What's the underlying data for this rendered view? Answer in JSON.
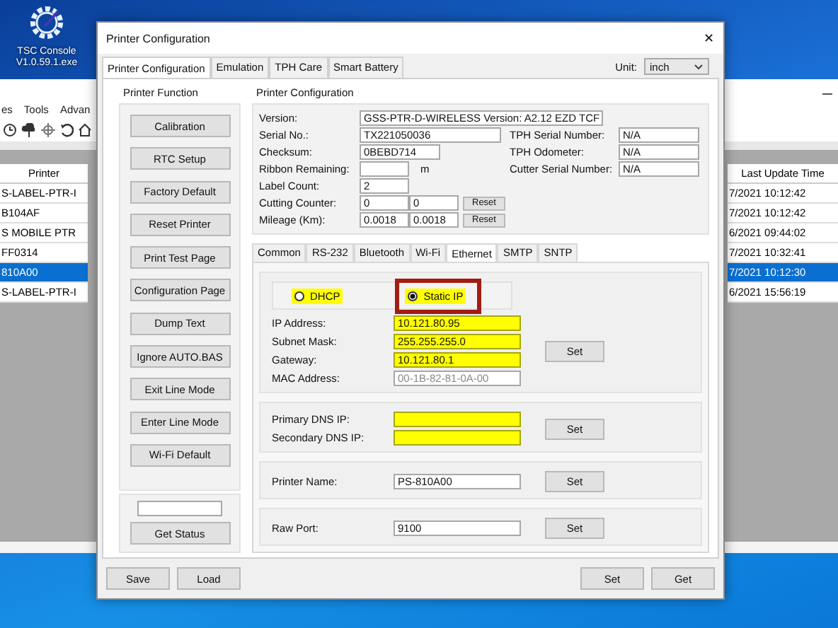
{
  "desktop_icon": {
    "label": "TSC Console V1.0.59.1.exe"
  },
  "background_window": {
    "menu": [
      "es",
      "Tools",
      "Advan"
    ],
    "columns": [
      "Printer",
      "Last Update Time"
    ],
    "rows": [
      {
        "printer": "S-LABEL-PTR-I",
        "time": "7/2021 10:12:42",
        "selected": false
      },
      {
        "printer": "B104AF",
        "time": "7/2021 10:12:42",
        "selected": false
      },
      {
        "printer": "S MOBILE PTR",
        "time": "6/2021 09:44:02",
        "selected": false
      },
      {
        "printer": "FF0314",
        "time": "7/2021 10:32:41",
        "selected": false
      },
      {
        "printer": "810A00",
        "time": "7/2021 10:12:30",
        "selected": true
      },
      {
        "printer": "S-LABEL-PTR-I",
        "time": "6/2021 15:56:19",
        "selected": false
      }
    ]
  },
  "dialog": {
    "title": "Printer Configuration",
    "close": "✕",
    "tabs": [
      {
        "label": "Printer Configuration",
        "selected": true
      },
      {
        "label": "Emulation",
        "selected": false
      },
      {
        "label": "TPH Care",
        "selected": false
      },
      {
        "label": "Smart Battery",
        "selected": false
      }
    ],
    "unit": {
      "label": "Unit:",
      "value": "inch"
    },
    "printer_function": {
      "title": "Printer Function",
      "buttons": [
        "Calibration",
        "RTC Setup",
        "Factory Default",
        "Reset Printer",
        "Print Test Page",
        "Configuration Page",
        "Dump Text",
        "Ignore AUTO.BAS",
        "Exit Line Mode",
        "Enter Line Mode",
        "Wi-Fi Default"
      ],
      "status_button": "Get Status"
    },
    "printer_configuration": {
      "title": "Printer Configuration",
      "version": {
        "label": "Version:",
        "value": "GSS-PTR-D-WIRELESS Version: A2.12 EZD TCF"
      },
      "serial": {
        "label": "Serial No.:",
        "value": "TX221050036"
      },
      "checksum": {
        "label": "Checksum:",
        "value": "0BEBD714"
      },
      "ribbon": {
        "label": "Ribbon Remaining:",
        "unit": "m"
      },
      "label_count": {
        "label": "Label Count:",
        "value": "2"
      },
      "cutting_counter": {
        "label": "Cutting Counter:",
        "values": [
          "0",
          "0"
        ],
        "button": "Reset"
      },
      "mileage": {
        "label": "Mileage (Km):",
        "values": [
          "0.0018",
          "0.0018"
        ],
        "button": "Reset"
      },
      "tph_serial": {
        "label": "TPH Serial Number:",
        "value": "N/A"
      },
      "tph_odometer": {
        "label": "TPH Odometer:",
        "value": "N/A"
      },
      "cutter_serial": {
        "label": "Cutter Serial Number:",
        "value": "N/A"
      }
    },
    "subtabs": [
      {
        "label": "Common",
        "selected": false
      },
      {
        "label": "RS-232",
        "selected": false
      },
      {
        "label": "Bluetooth",
        "selected": false
      },
      {
        "label": "Wi-Fi",
        "selected": false
      },
      {
        "label": "Ethernet",
        "selected": true
      },
      {
        "label": "SMTP",
        "selected": false
      },
      {
        "label": "SNTP",
        "selected": false
      }
    ],
    "ethernet": {
      "modes": [
        {
          "label": "DHCP",
          "selected": false,
          "highlighted": true,
          "annotated": false
        },
        {
          "label": "Static IP",
          "selected": true,
          "highlighted": true,
          "annotated": true
        }
      ],
      "groups": [
        {
          "fields": [
            {
              "label": "IP Address:",
              "value": "10.121.80.95",
              "highlighted": true,
              "disabled": false
            },
            {
              "label": "Subnet Mask:",
              "value": "255.255.255.0",
              "highlighted": true,
              "disabled": false
            },
            {
              "label": "Gateway:",
              "value": "10.121.80.1",
              "highlighted": true,
              "disabled": false
            },
            {
              "label": "MAC Address:",
              "value": "00-1B-82-81-0A-00",
              "highlighted": false,
              "disabled": true
            }
          ],
          "button": "Set"
        },
        {
          "fields": [
            {
              "label": "Primary DNS IP:",
              "highlighted": true
            },
            {
              "label": "Secondary DNS IP:",
              "highlighted": true
            }
          ],
          "button": "Set"
        },
        {
          "fields": [
            {
              "label": "Printer Name:",
              "value": "PS-810A00",
              "highlighted": false
            }
          ],
          "button": "Set"
        },
        {
          "fields": [
            {
              "label": "Raw Port:",
              "value": "9100",
              "highlighted": false
            }
          ],
          "button": "Set"
        }
      ]
    },
    "footer_left": [
      "Save",
      "Load"
    ],
    "footer_right": [
      "Set",
      "Get"
    ]
  }
}
